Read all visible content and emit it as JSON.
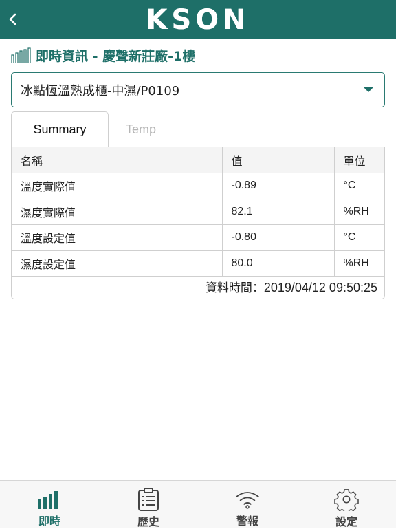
{
  "header": {
    "back_label": "<",
    "logo": "KSON"
  },
  "page": {
    "heading": "即時資訊 - 慶聲新莊廠-1樓"
  },
  "device_select": {
    "selected": "冰點恆溫熟成櫃-中濕/P0109"
  },
  "tabs": [
    {
      "label": "Summary",
      "active": true
    },
    {
      "label": "Temp",
      "active": false
    }
  ],
  "table": {
    "headers": [
      "名稱",
      "值",
      "單位"
    ],
    "rows": [
      {
        "name": "溫度實際值",
        "value": "-0.89",
        "unit": "°C"
      },
      {
        "name": "濕度實際值",
        "value": "82.1",
        "unit": "%RH"
      },
      {
        "name": "溫度設定值",
        "value": "-0.80",
        "unit": "°C"
      },
      {
        "name": "濕度設定值",
        "value": "80.0",
        "unit": "%RH"
      }
    ],
    "timestamp_label": "資料時間：",
    "timestamp_value": "2019/04/12 09:50:25"
  },
  "bottom_nav": [
    {
      "label": "即時",
      "icon": "bar-chart-icon",
      "active": true
    },
    {
      "label": "歷史",
      "icon": "clipboard-icon",
      "active": false
    },
    {
      "label": "警報",
      "icon": "wifi-signal-icon",
      "active": false
    },
    {
      "label": "設定",
      "icon": "gear-icon",
      "active": false
    }
  ],
  "colors": {
    "brand": "#1e6f68",
    "inactive_tab": "#b5b5b5"
  }
}
